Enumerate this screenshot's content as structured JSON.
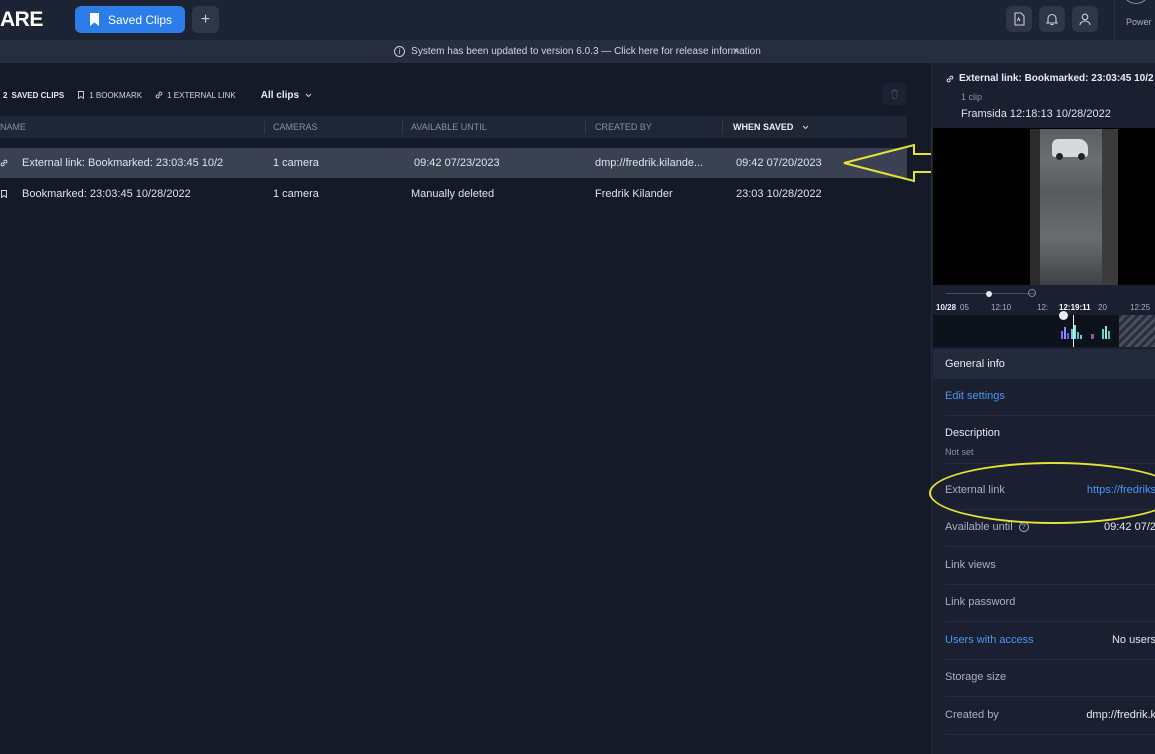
{
  "topbar": {
    "logo": "ARE",
    "active_tab": "Saved Clips",
    "add_tab": "+",
    "power_label": "Power"
  },
  "notice": {
    "text": "System has been updated to version 6.0.3 — Click here for release information",
    "close": "×"
  },
  "filters": {
    "saved_clips_count": "2",
    "saved_clips_label": "SAVED CLIPS",
    "bookmark": "1 BOOKMARK",
    "external_link": "1 EXTERNAL LINK",
    "dropdown": "All clips"
  },
  "table": {
    "headers": [
      "NAME",
      "CAMERAS",
      "AVAILABLE UNTIL",
      "CREATED BY",
      "WHEN SAVED"
    ],
    "rows": [
      {
        "name": "External link: Bookmarked: 23:03:45 10/2",
        "cameras": "1 camera",
        "available_until": "09:42 07/23/2023",
        "created_by": "dmp://fredrik.kilande...",
        "when_saved": "09:42 07/20/2023"
      },
      {
        "name": "Bookmarked: 23:03:45 10/28/2022",
        "cameras": "1 camera",
        "available_until": "Manually deleted",
        "created_by": "Fredrik Kilander",
        "when_saved": "23:03 10/28/2022"
      }
    ]
  },
  "panel": {
    "title": "External link: Bookmarked: 23:03:45 10/2",
    "subtitle": "1 clip",
    "clip": "Framsida 12:18:13 10/28/2022",
    "timeline_labels": [
      "10/28",
      "05",
      "12:10",
      "12:",
      "12:19:11",
      "20",
      "12:25"
    ],
    "general_info": "General info",
    "edit_settings": "Edit settings",
    "description_label": "Description",
    "description_value": "Not set",
    "external_link_label": "External link",
    "external_link_value": "https://fredriks",
    "available_until_label": "Available until",
    "available_until_value": "09:42 07/2",
    "link_views_label": "Link views",
    "link_password_label": "Link password",
    "users_access_label": "Users with access",
    "users_access_value": "No users",
    "storage_size_label": "Storage size",
    "created_by_label": "Created by",
    "created_by_value": "dmp://fredrik.k",
    "help": "?"
  },
  "colors": {
    "accent": "#2b7de9",
    "link": "#4a96f5",
    "annotation": "#e6e23a"
  }
}
